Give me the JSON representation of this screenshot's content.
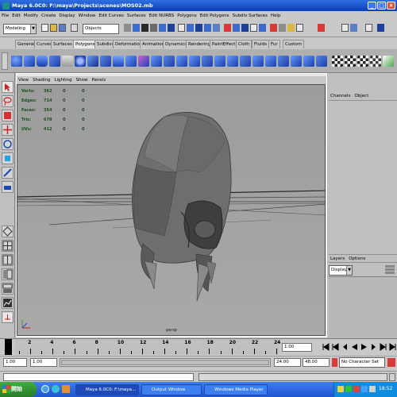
{
  "window": {
    "title": "Maya 6.0C0: F:\\maya\\Projects\\scenes\\MOS02.mb",
    "controls": {
      "min": "_",
      "max": "□",
      "close": "×"
    }
  },
  "menubar": [
    "File",
    "Edit",
    "Modify",
    "Create",
    "Display",
    "Window",
    "Edit Curves",
    "Surfaces",
    "Edit NURBS",
    "Polygons",
    "Edit Polygons",
    "Subdiv Surfaces",
    "Help"
  ],
  "statusline": {
    "mode_menu": "Modeling",
    "selection_mask": "Objects"
  },
  "shelf": {
    "tabs": [
      "General",
      "Curves",
      "Surfaces",
      "Polygons",
      "Subdivs",
      "Deformation",
      "Animation",
      "Dynamics",
      "Rendering",
      "PaintEffects",
      "Cloth",
      "Fluids",
      "Fur",
      "Custom"
    ],
    "active_tab": "Polygons"
  },
  "panel": {
    "menus": [
      "View",
      "Shading",
      "Lighting",
      "Show",
      "Panels"
    ],
    "camera_label": "persp",
    "hud": [
      {
        "label": "Verts:",
        "values": [
          "362",
          "0",
          "0"
        ]
      },
      {
        "label": "Edges:",
        "values": [
          "714",
          "0",
          "0"
        ]
      },
      {
        "label": "Faces:",
        "values": [
          "354",
          "0",
          "0"
        ]
      },
      {
        "label": "Tris:",
        "values": [
          "678",
          "0",
          "0"
        ]
      },
      {
        "label": "UVs:",
        "values": [
          "412",
          "0",
          "0"
        ]
      }
    ]
  },
  "channelbox": {
    "menus": [
      "Channels",
      "Object"
    ]
  },
  "layers": {
    "menus": [
      "Layers",
      "Options"
    ],
    "layer_type": "Display"
  },
  "timeslider": {
    "ticks": [
      "2",
      "4",
      "6",
      "8",
      "10",
      "12",
      "14",
      "16",
      "18",
      "20",
      "22",
      "24"
    ],
    "current_time": "1.00"
  },
  "rangeslider": {
    "start_time": "1.00",
    "playback_start": "1.00",
    "playback_end": "24.00",
    "end_time": "48.00",
    "character_set": "No Character Set"
  },
  "taskbar": {
    "start_label": "開始",
    "tasks": [
      "Maya 6.0C0: F:\\maya...",
      "Output Window",
      "Windows Media Player"
    ],
    "clock": "18:52"
  },
  "colors": {
    "maya_blue": "#1f5fc9",
    "viewport_bg": "#a3a3a3",
    "hud_text": "#1e4f1e",
    "taskbar": "#2a62da"
  }
}
